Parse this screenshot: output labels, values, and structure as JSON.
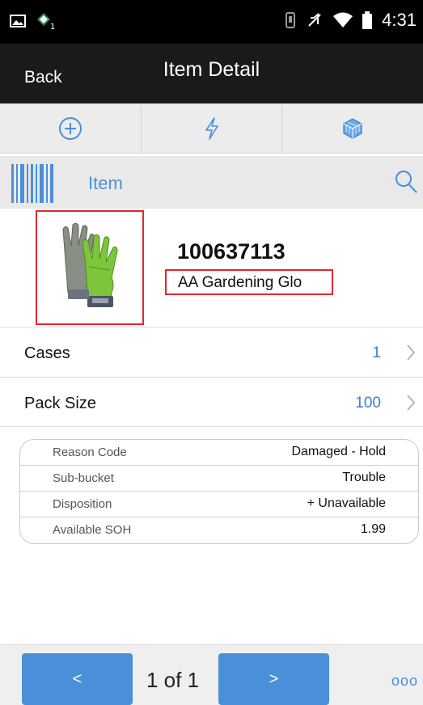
{
  "status_bar": {
    "time": "4:31",
    "icons": [
      "image-icon",
      "maps-notification-icon",
      "vibrate-icon",
      "mute-icon",
      "wifi-icon",
      "battery-icon"
    ]
  },
  "header": {
    "back_label": "Back",
    "title": "Item Detail"
  },
  "toolbar": {
    "icons": [
      "add-circle-icon",
      "lightning-icon",
      "cube-icon"
    ]
  },
  "scan": {
    "label": "Item",
    "icons": [
      "barcode-icon",
      "search-icon"
    ]
  },
  "item": {
    "id": "100637113",
    "description": "AA Gardening Glo",
    "image": "gardening-gloves-image"
  },
  "rows": [
    {
      "label": "Cases",
      "value": "1"
    },
    {
      "label": "Pack Size",
      "value": "100"
    }
  ],
  "details": [
    {
      "label": "Reason Code",
      "value": "Damaged - Hold"
    },
    {
      "label": "Sub-bucket",
      "value": "Trouble"
    },
    {
      "label": "Disposition",
      "value": "+ Unavailable"
    },
    {
      "label": "Available SOH",
      "value": "1.99"
    }
  ],
  "footer": {
    "prev_label": "<",
    "next_label": ">",
    "pager_text": "1 of 1",
    "more_label": "ooo"
  },
  "colors": {
    "accent": "#4a90d9",
    "highlight": "#e0282e",
    "titlebar": "#1a1a1a"
  }
}
